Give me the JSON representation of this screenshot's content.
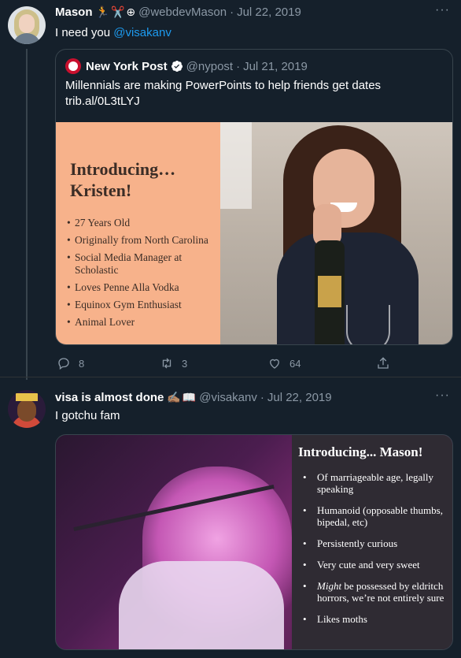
{
  "tweet1": {
    "name": "Mason",
    "name_emojis": [
      "🏃",
      "✂️",
      "⊕"
    ],
    "handle": "@webdevMason",
    "date": "Jul 22, 2019",
    "text_prefix": "I need you ",
    "mention": "@visakanv",
    "quote": {
      "name": "New York Post",
      "handle": "@nypost",
      "date": "Jul 21, 2019",
      "text_line1": "Millennials are making PowerPoints to help friends get dates",
      "text_line2": "trib.al/0L3tLYJ",
      "slide": {
        "title": "Introducing… Kristen!",
        "items": [
          "27 Years Old",
          "Originally from North Carolina",
          "Social Media Manager at Scholastic",
          "Loves Penne Alla Vodka",
          "Equinox Gym Enthusiast",
          "Animal Lover"
        ]
      }
    },
    "actions": {
      "replies": "8",
      "retweets": "3",
      "likes": "64"
    }
  },
  "tweet2": {
    "name": "visa is almost done",
    "name_emojis": [
      "✍🏽",
      "📖"
    ],
    "handle": "@visakanv",
    "date": "Jul 22, 2019",
    "text": "I gotchu fam",
    "slide": {
      "title": "Introducing... Mason!",
      "items": [
        {
          "pre": "",
          "em": "",
          "text": "Of marriageable age, legally speaking"
        },
        {
          "pre": "",
          "em": "",
          "text": "Humanoid (opposable thumbs, bipedal, etc)"
        },
        {
          "pre": "",
          "em": "",
          "text": "Persistently curious"
        },
        {
          "pre": "",
          "em": "",
          "text": "Very cute and very sweet"
        },
        {
          "pre": "",
          "em": "Might",
          "text": " be possessed by eldritch horrors, we’re not entirely sure"
        },
        {
          "pre": "",
          "em": "",
          "text": "Likes moths"
        }
      ]
    }
  },
  "ui": {
    "more_label": "···",
    "dot": "·"
  },
  "colors": {
    "background": "#15202b",
    "accent": "#1d9bf0",
    "muted": "#8b98a5",
    "border": "#38444d",
    "slide_peach": "#f7b28b"
  },
  "icons": [
    "reply-icon",
    "retweet-icon",
    "like-icon",
    "share-icon",
    "verified-icon",
    "more-icon"
  ]
}
